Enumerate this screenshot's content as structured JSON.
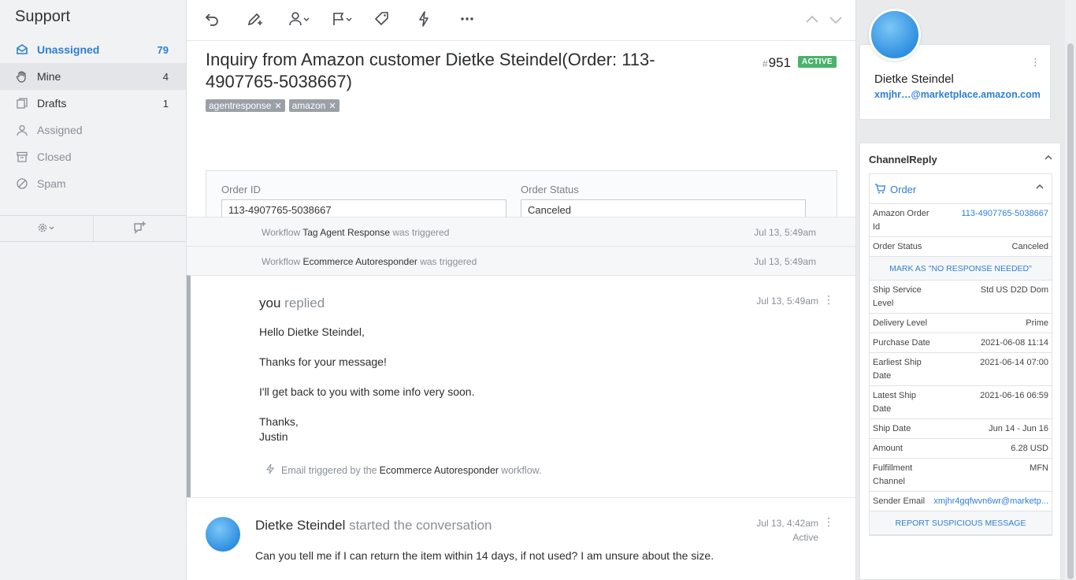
{
  "sidebar": {
    "title": "Support",
    "items": [
      {
        "label": "Unassigned",
        "count": "79",
        "icon": "inbox-icon"
      },
      {
        "label": "Mine",
        "count": "4",
        "icon": "hand-icon"
      },
      {
        "label": "Drafts",
        "count": "1",
        "icon": "drafts-icon"
      },
      {
        "label": "Assigned",
        "count": "",
        "icon": "user-icon"
      },
      {
        "label": "Closed",
        "count": "",
        "icon": "archive-icon"
      },
      {
        "label": "Spam",
        "count": "",
        "icon": "block-icon"
      }
    ]
  },
  "conversation": {
    "subject": "Inquiry from Amazon customer Dietke Steindel(Order: 113-4907765-5038667)",
    "number": "951",
    "hash": "#",
    "status": "ACTIVE",
    "tags": [
      "agentresponse",
      "amazon"
    ],
    "order_id_label": "Order ID",
    "order_id_value": "113-4907765-5038667",
    "order_status_label": "Order Status",
    "order_status_value": "Canceled"
  },
  "activities": [
    {
      "prefix": "Workflow",
      "name": "Tag Agent Response",
      "suffix": "was triggered",
      "time": "Jul 13, 5:49am"
    },
    {
      "prefix": "Workflow",
      "name": "Ecommerce Autoresponder",
      "suffix": "was triggered",
      "time": "Jul 13, 5:49am"
    }
  ],
  "reply": {
    "author": "you",
    "action": "replied",
    "time": "Jul 13, 5:49am",
    "lines": [
      "Hello Dietke Steindel,",
      "Thanks for your message!",
      "I'll get back to you with some info very soon.",
      "Thanks,",
      "Justin"
    ],
    "note_prefix": "Email triggered by the",
    "note_workflow": "Ecommerce Autoresponder",
    "note_suffix": "workflow."
  },
  "customer_msg": {
    "author": "Dietke Steindel",
    "action": "started the conversation",
    "time": "Jul 13, 4:42am",
    "status": "Active",
    "body": "Can you tell me if I can return the item within 14 days, if not used? I am unsure about the size."
  },
  "customer_card": {
    "name": "Dietke Steindel",
    "email": "xmjhr…@marketplace.amazon.com"
  },
  "channelreply": {
    "title": "ChannelReply",
    "order_label": "Order",
    "rows": [
      {
        "k": "Amazon Order Id",
        "v": "113-4907765-5038667",
        "link": true
      },
      {
        "k": "Order Status",
        "v": "Canceled"
      },
      {
        "action": "MARK AS \"NO RESPONSE NEEDED\""
      },
      {
        "k": "Ship Service Level",
        "v": "Std US D2D Dom"
      },
      {
        "k": "Delivery Level",
        "v": "Prime"
      },
      {
        "k": "Purchase Date",
        "v": "2021-06-08 11:14"
      },
      {
        "k": "Earliest Ship Date",
        "v": "2021-06-14 07:00"
      },
      {
        "k": "Latest Ship Date",
        "v": "2021-06-16 06:59"
      },
      {
        "k": "Ship Date",
        "v": "Jun 14 - Jun 16"
      },
      {
        "k": "Amount",
        "v": "6.28 USD"
      },
      {
        "k": "Fulfillment Channel",
        "v": "MFN"
      },
      {
        "k": "Sender Email",
        "v": "xmjhr4gqfwvn6wr@marketp...",
        "link": true
      },
      {
        "action": "REPORT SUSPICIOUS MESSAGE"
      }
    ]
  },
  "colors": {
    "accent": "#2e7fd5",
    "active_badge": "#4ab36b"
  }
}
